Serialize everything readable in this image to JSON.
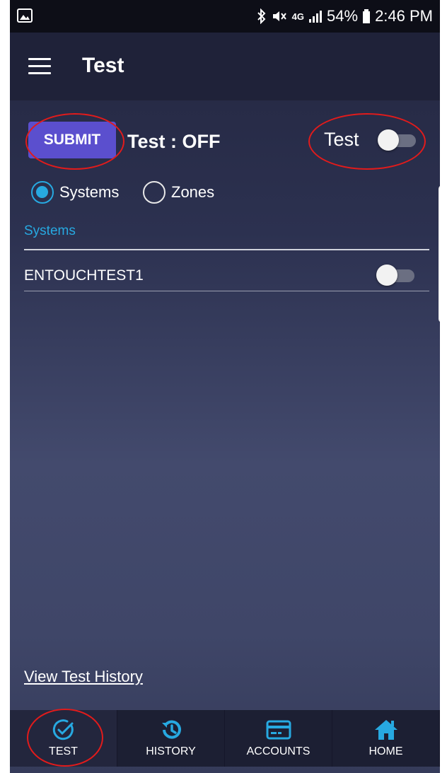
{
  "status_bar": {
    "battery_percent": "54%",
    "time": "2:46 PM",
    "network": "4G"
  },
  "app_bar": {
    "title": "Test"
  },
  "controls": {
    "submit_label": "SUBMIT",
    "status_text": "Test : OFF",
    "toggle_label": "Test",
    "toggle_on": false
  },
  "filter": {
    "options": [
      "Systems",
      "Zones"
    ],
    "selected": "Systems"
  },
  "section": {
    "header": "Systems",
    "items": [
      {
        "name": "ENTOUCHTEST1",
        "toggle_on": false
      }
    ]
  },
  "links": {
    "view_history": "View Test History"
  },
  "bottom_nav": {
    "items": [
      {
        "label": "TEST",
        "icon": "check-circle-icon",
        "active": true
      },
      {
        "label": "HISTORY",
        "icon": "history-icon",
        "active": false
      },
      {
        "label": "ACCOUNTS",
        "icon": "card-icon",
        "active": false
      },
      {
        "label": "HOME",
        "icon": "home-icon",
        "active": false
      }
    ]
  },
  "colors": {
    "accent": "#27a9e1",
    "submit": "#5b4fce",
    "annotation": "#e21b1b"
  }
}
